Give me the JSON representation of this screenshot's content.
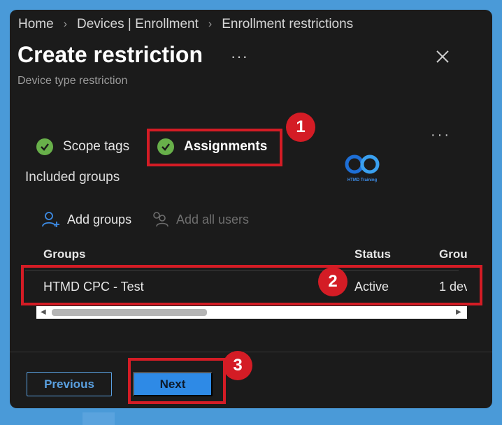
{
  "breadcrumb": {
    "items": [
      "Home",
      "Devices | Enrollment",
      "Enrollment restrictions"
    ]
  },
  "header": {
    "title": "Create restriction",
    "more": "···",
    "subtitle": "Device type restriction"
  },
  "steps": [
    {
      "label": "Scope tags",
      "status": "complete"
    },
    {
      "label": "Assignments",
      "status": "current"
    }
  ],
  "steps_more": "···",
  "annotations": [
    "1",
    "2",
    "3"
  ],
  "logo": {
    "text": "HTMD Training"
  },
  "assignments": {
    "section_label": "Included groups",
    "actions": {
      "add_groups": "Add groups",
      "add_all_users": "Add all users"
    },
    "columns": [
      "Groups",
      "Status",
      "Grou"
    ],
    "rows": [
      {
        "group": "HTMD CPC - Test",
        "status": "Active",
        "extra": "1 dev"
      }
    ]
  },
  "footer": {
    "previous_label": "Previous",
    "next_label": "Next"
  },
  "colors": {
    "accent": "#2e8ae6",
    "success": "#68b04a",
    "annotation": "#d41c25",
    "panel": "#1b1b1b",
    "frame": "#4a9ad8"
  }
}
